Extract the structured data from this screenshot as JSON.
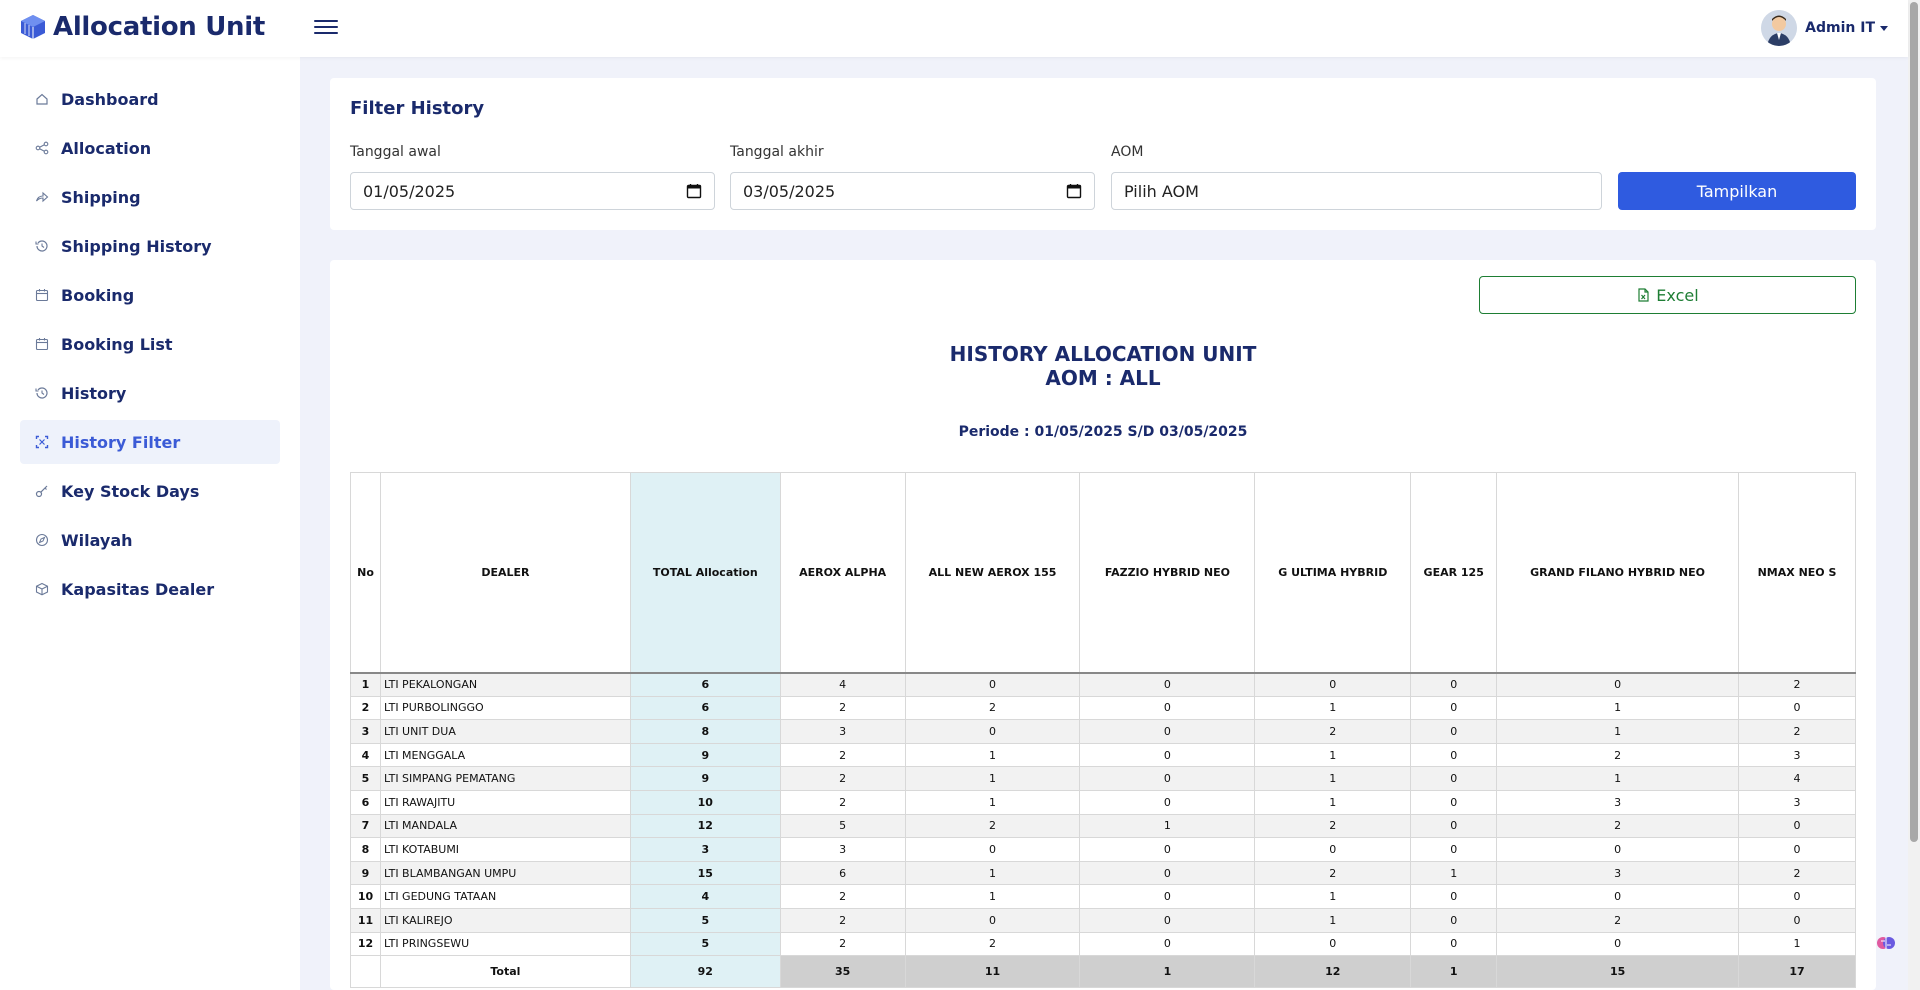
{
  "app": {
    "title": "Allocation Unit"
  },
  "user": {
    "name": "Admin IT"
  },
  "sidebar": {
    "items": [
      {
        "label": "Dashboard",
        "icon": "home-icon"
      },
      {
        "label": "Allocation",
        "icon": "share-icon"
      },
      {
        "label": "Shipping",
        "icon": "forward-icon"
      },
      {
        "label": "Shipping History",
        "icon": "history-icon"
      },
      {
        "label": "Booking",
        "icon": "calendar-icon"
      },
      {
        "label": "Booking List",
        "icon": "calendar-icon"
      },
      {
        "label": "History",
        "icon": "history-icon"
      },
      {
        "label": "History Filter",
        "icon": "filter-icon",
        "active": true
      },
      {
        "label": "Key Stock Days",
        "icon": "key-icon"
      },
      {
        "label": "Wilayah",
        "icon": "compass-icon"
      },
      {
        "label": "Kapasitas Dealer",
        "icon": "box-icon"
      }
    ]
  },
  "filter": {
    "title": "Filter History",
    "start_label": "Tanggal awal",
    "start_value": "01/05/2025",
    "end_label": "Tanggal akhir",
    "end_value": "03/05/2025",
    "aom_label": "AOM",
    "aom_value": "Pilih AOM",
    "submit_label": "Tampilkan"
  },
  "report": {
    "excel_label": "Excel",
    "title_line1": "HISTORY ALLOCATION UNIT",
    "title_line2": "AOM : ALL",
    "period": "Periode : 01/05/2025 S/D 03/05/2025"
  },
  "table": {
    "headers": [
      "No",
      "DEALER",
      "TOTAL Allocation",
      "AEROX ALPHA",
      "ALL NEW AEROX 155",
      "FAZZIO HYBRID NEO",
      "G ULTIMA HYBRID",
      "GEAR 125",
      "GRAND FILANO HYBRID NEO",
      "NMAX NEO S"
    ],
    "rows": [
      [
        "1",
        "LTI PEKALONGAN",
        "6",
        "4",
        "0",
        "0",
        "0",
        "0",
        "0",
        "2"
      ],
      [
        "2",
        "LTI PURBOLINGGO",
        "6",
        "2",
        "2",
        "0",
        "1",
        "0",
        "1",
        "0"
      ],
      [
        "3",
        "LTI UNIT DUA",
        "8",
        "3",
        "0",
        "0",
        "2",
        "0",
        "1",
        "2"
      ],
      [
        "4",
        "LTI MENGGALA",
        "9",
        "2",
        "1",
        "0",
        "1",
        "0",
        "2",
        "3"
      ],
      [
        "5",
        "LTI SIMPANG PEMATANG",
        "9",
        "2",
        "1",
        "0",
        "1",
        "0",
        "1",
        "4"
      ],
      [
        "6",
        "LTI RAWAJITU",
        "10",
        "2",
        "1",
        "0",
        "1",
        "0",
        "3",
        "3"
      ],
      [
        "7",
        "LTI MANDALA",
        "12",
        "5",
        "2",
        "1",
        "2",
        "0",
        "2",
        "0"
      ],
      [
        "8",
        "LTI KOTABUMI",
        "3",
        "3",
        "0",
        "0",
        "0",
        "0",
        "0",
        "0"
      ],
      [
        "9",
        "LTI BLAMBANGAN UMPU",
        "15",
        "6",
        "1",
        "0",
        "2",
        "1",
        "3",
        "2"
      ],
      [
        "10",
        "LTI GEDUNG TATAAN",
        "4",
        "2",
        "1",
        "0",
        "1",
        "0",
        "0",
        "0"
      ],
      [
        "11",
        "LTI KALIREJO",
        "5",
        "2",
        "0",
        "0",
        "1",
        "0",
        "2",
        "0"
      ],
      [
        "12",
        "LTI PRINGSEWU",
        "5",
        "2",
        "2",
        "0",
        "0",
        "0",
        "0",
        "1"
      ]
    ],
    "total_label": "Total",
    "totals": [
      "92",
      "35",
      "11",
      "1",
      "12",
      "1",
      "15",
      "17"
    ]
  }
}
